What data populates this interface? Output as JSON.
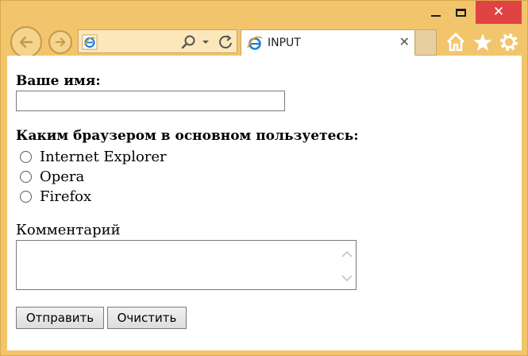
{
  "window": {
    "caption": {
      "minimize": "minimize",
      "maximize": "maximize",
      "close": "✕"
    }
  },
  "tab": {
    "title": "INPUT",
    "close": "✕"
  },
  "form": {
    "name_label": "Ваше имя:",
    "name_value": "",
    "browser_label": "Каким браузером в основном пользуетесь:",
    "browser_options": [
      "Internet Explorer",
      "Opera",
      "Firefox"
    ],
    "comment_label": "Комментарий",
    "comment_value": "",
    "submit_label": "Отправить",
    "reset_label": "Очистить"
  },
  "colors": {
    "frame": "#f2c56d",
    "close_button": "#e04343",
    "ie_blue": "#1f7fd6",
    "ie_orange": "#f0a020"
  },
  "icons": [
    "back-icon",
    "forward-icon",
    "ie-favicon-icon",
    "search-icon",
    "dropdown-icon",
    "refresh-icon",
    "home-icon",
    "favorites-star-icon",
    "settings-gear-icon"
  ]
}
